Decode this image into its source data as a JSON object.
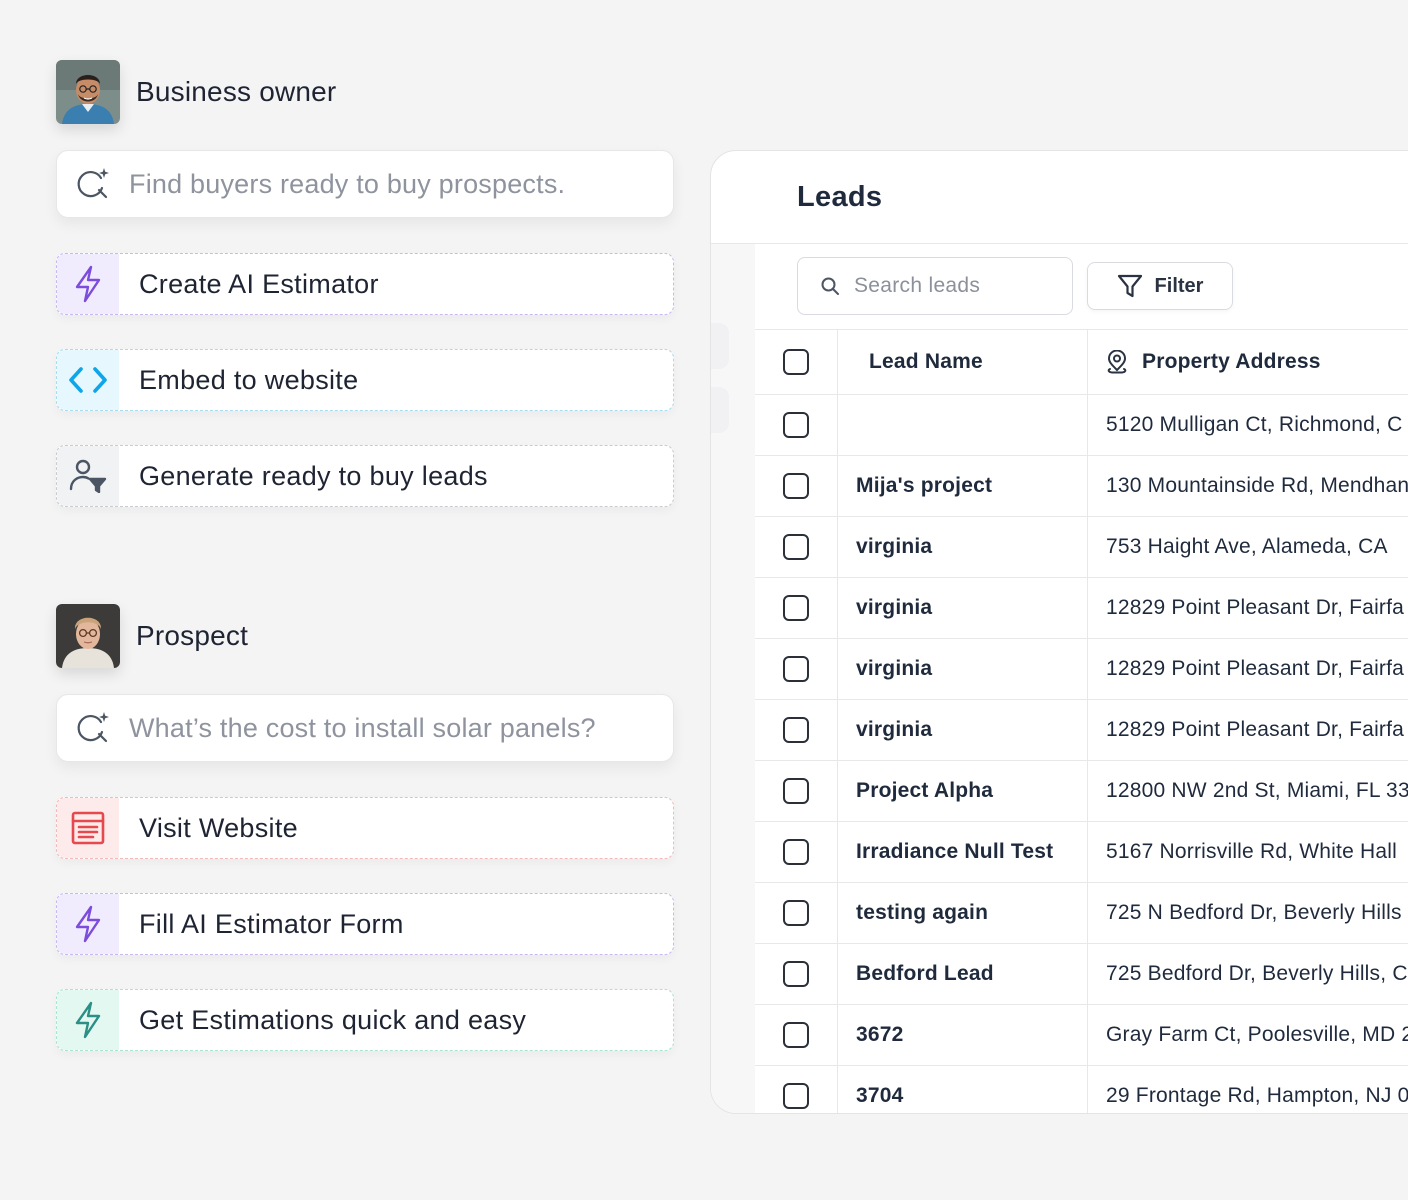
{
  "business_owner": {
    "name": "Business owner",
    "query": "Find buyers ready to buy prospects.",
    "steps": [
      {
        "label": "Create AI Estimator",
        "icon": "lightning-icon"
      },
      {
        "label": "Embed to website",
        "icon": "code-brackets-icon"
      },
      {
        "label": "Generate ready to buy leads",
        "icon": "user-filter-icon"
      }
    ]
  },
  "prospect": {
    "name": "Prospect",
    "query": "What’s the cost to install solar panels?",
    "steps": [
      {
        "label": "Visit Website",
        "icon": "webpage-icon"
      },
      {
        "label": "Fill AI Estimator Form",
        "icon": "lightning-icon"
      },
      {
        "label": "Get Estimations quick and easy",
        "icon": "lightning-icon"
      }
    ]
  },
  "leads": {
    "title": "Leads",
    "search_placeholder": "Search leads",
    "filter_label": "Filter",
    "columns": {
      "name": "Lead Name",
      "address": "Property Address"
    },
    "rows": [
      {
        "name": "",
        "address": "5120 Mulligan Ct, Richmond, C"
      },
      {
        "name": "Mija's project",
        "address": "130 Mountainside Rd, Mendhan"
      },
      {
        "name": "virginia",
        "address": "753 Haight Ave, Alameda, CA"
      },
      {
        "name": "virginia",
        "address": "12829 Point Pleasant Dr, Fairfa"
      },
      {
        "name": "virginia",
        "address": "12829 Point Pleasant Dr, Fairfa"
      },
      {
        "name": "virginia",
        "address": "12829 Point Pleasant Dr, Fairfa"
      },
      {
        "name": "Project Alpha",
        "address": "12800 NW 2nd St, Miami, FL 33"
      },
      {
        "name": "Irradiance Null Test",
        "address": "5167 Norrisville Rd, White Hall"
      },
      {
        "name": "testing again",
        "address": "725 N Bedford Dr, Beverly Hills"
      },
      {
        "name": "Bedford Lead",
        "address": "725 Bedford Dr, Beverly Hills, C"
      },
      {
        "name": "3672",
        "address": "Gray Farm Ct, Poolesville, MD 2"
      },
      {
        "name": "3704",
        "address": "29 Frontage Rd, Hampton, NJ 0"
      }
    ]
  },
  "colors": {
    "background": "#f4f4f4",
    "purple_accent": "#8b5cf6",
    "cyan_accent": "#0ea5e9",
    "red_accent": "#e5484d",
    "teal_accent": "#2a9d8f"
  }
}
